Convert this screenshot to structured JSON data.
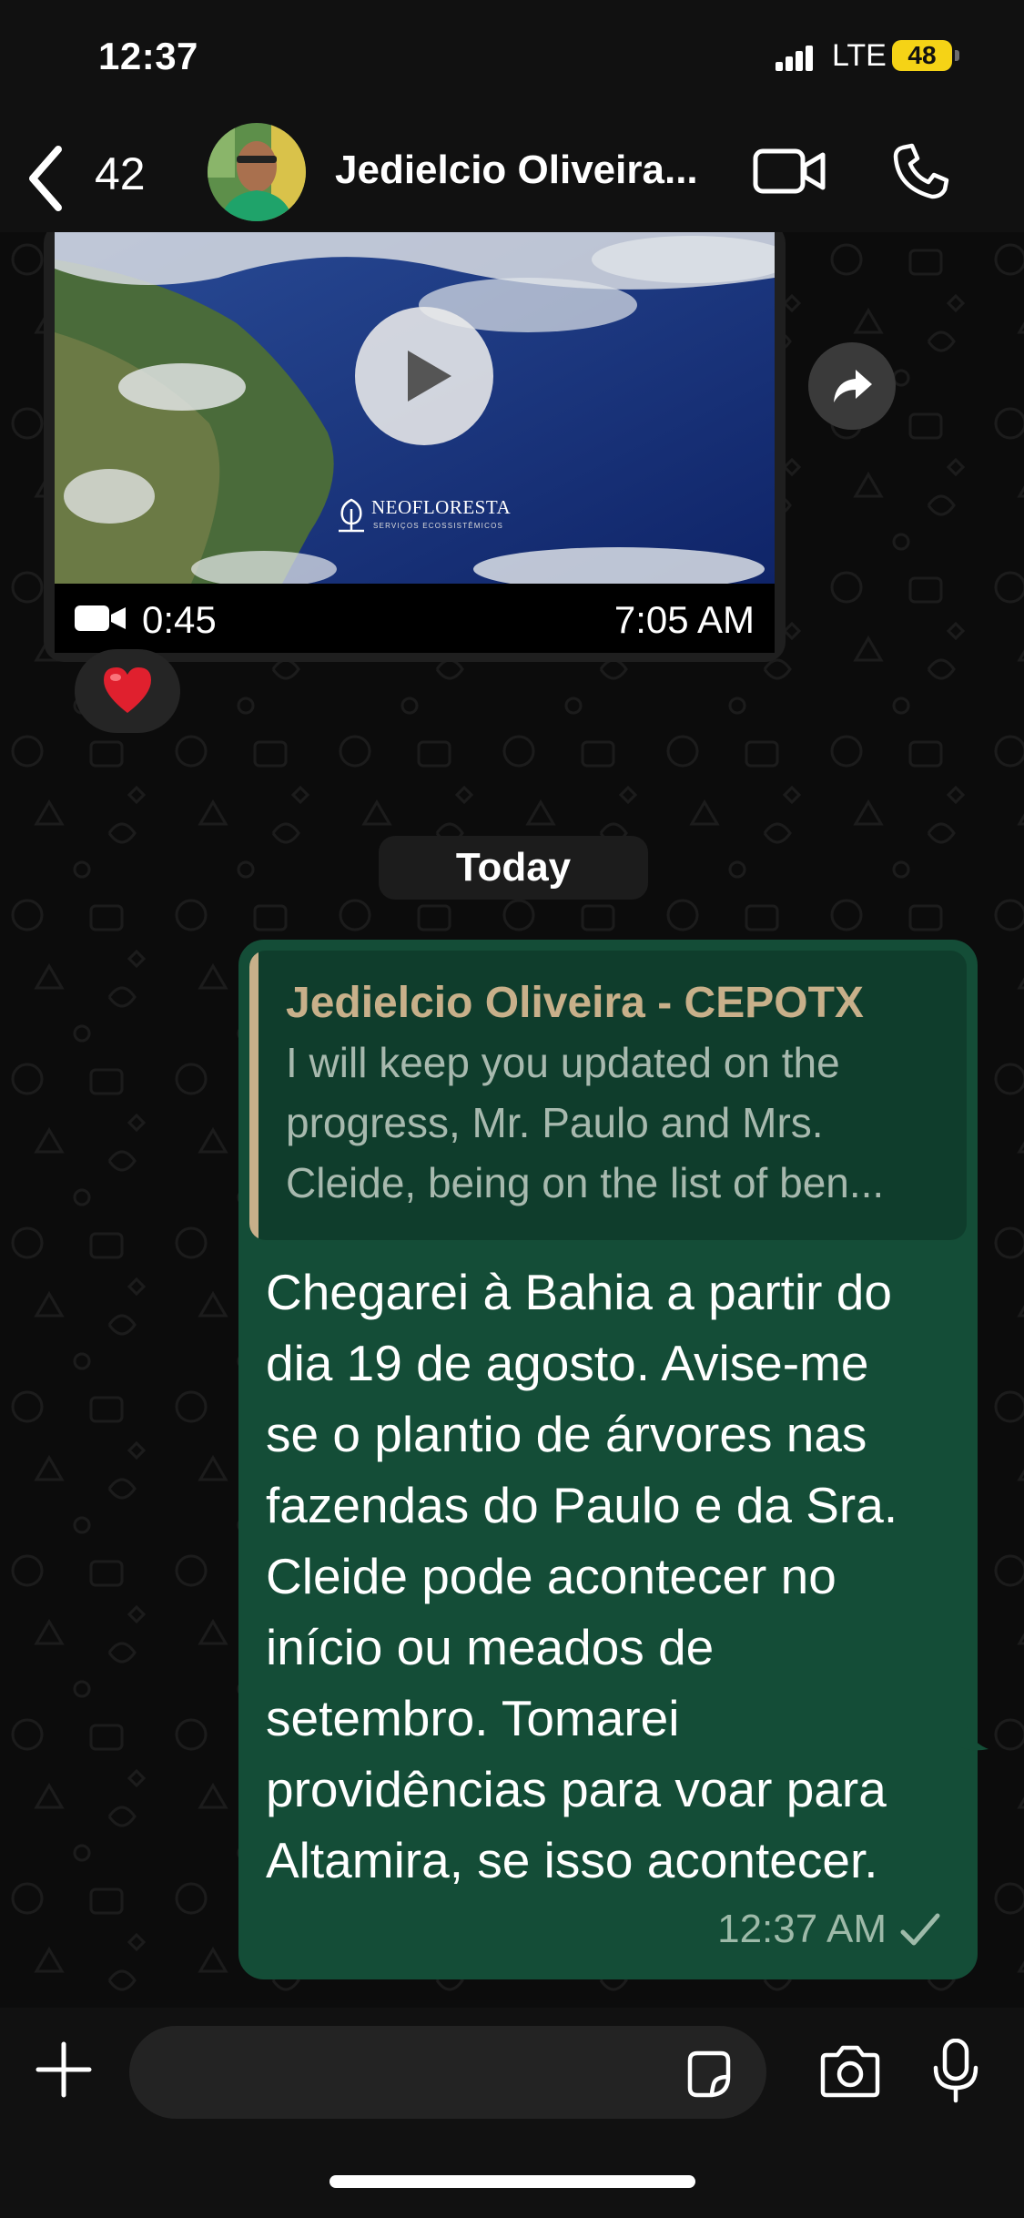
{
  "status_bar": {
    "time": "12:37",
    "network": "LTE",
    "battery": "48",
    "battery_color": "#f5d316"
  },
  "header": {
    "back_count": "42",
    "contact_name": "Jedielcio Oliveira...",
    "icons": [
      "chevron-left-icon",
      "video-camera-icon",
      "phone-icon"
    ]
  },
  "video_message": {
    "brand_name": "NEOFLORESTA",
    "brand_subtitle": "SERVIÇOS ECOSSISTÊMICOS",
    "duration": "0:45",
    "time": "7:05 AM",
    "reaction": "❤️"
  },
  "date_divider": "Today",
  "sent_message": {
    "quoted_author": "Jedielcio Oliveira - CEPOTX",
    "quoted_lines": [
      "I will keep you updated on the",
      "progress, Mr. Paulo and Mrs.",
      "Cleide, being on the list of ben..."
    ],
    "lines": [
      "Chegarei à Bahia a partir do",
      "dia 19 de agosto. Avise-me",
      "se o plantio de árvores nas",
      "fazendas do Paulo e da Sra.",
      "Cleide pode acontecer no",
      "início ou meados de",
      "setembro. Tomarei",
      "providências para voar para",
      "Altamira, se isso acontecer."
    ],
    "time": "12:37 AM",
    "status_icon": "check-icon",
    "bubble_color": "#144d37"
  },
  "input_bar": {
    "placeholder": "",
    "icons": [
      "plus-icon",
      "sticker-icon",
      "camera-icon",
      "microphone-icon"
    ]
  }
}
